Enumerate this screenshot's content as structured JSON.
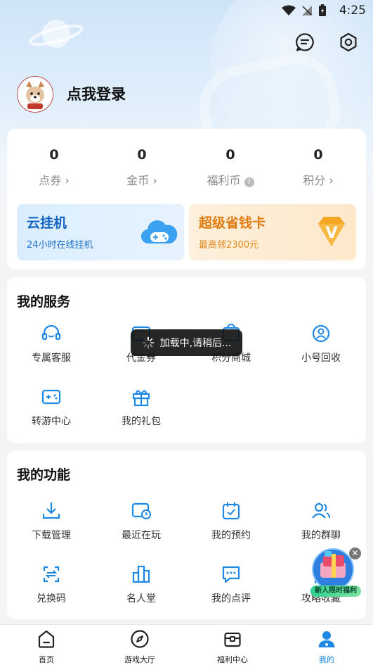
{
  "status": {
    "time": "4:25"
  },
  "user": {
    "login_label": "点我登录"
  },
  "stats": [
    {
      "value": "0",
      "label": "点券"
    },
    {
      "value": "0",
      "label": "金币"
    },
    {
      "value": "0",
      "label": "福利币"
    },
    {
      "value": "0",
      "label": "积分"
    }
  ],
  "promos": {
    "cloud": {
      "title": "云挂机",
      "subtitle": "24小时在线挂机"
    },
    "saver": {
      "title": "超级省钱卡",
      "subtitle": "最高领2300元"
    }
  },
  "services": {
    "title": "我的服务",
    "items": [
      {
        "label": "专属客服"
      },
      {
        "label": "代金券"
      },
      {
        "label": "积分商城"
      },
      {
        "label": "小号回收"
      },
      {
        "label": "转游中心"
      },
      {
        "label": "我的礼包"
      }
    ]
  },
  "features": {
    "title": "我的功能",
    "items": [
      {
        "label": "下载管理"
      },
      {
        "label": "最近在玩"
      },
      {
        "label": "我的预约"
      },
      {
        "label": "我的群聊"
      },
      {
        "label": "兑换码"
      },
      {
        "label": "名人堂"
      },
      {
        "label": "我的点评"
      },
      {
        "label": "攻略收藏"
      }
    ]
  },
  "toast": {
    "text": "加载中,请稍后..."
  },
  "float_badge": {
    "label": "新人限时福利"
  },
  "tabs": [
    {
      "label": "首页"
    },
    {
      "label": "游戏大厅"
    },
    {
      "label": "福利中心"
    },
    {
      "label": "我的"
    }
  ],
  "colors": {
    "accent": "#1e88e5",
    "gold": "#e08a1c"
  }
}
